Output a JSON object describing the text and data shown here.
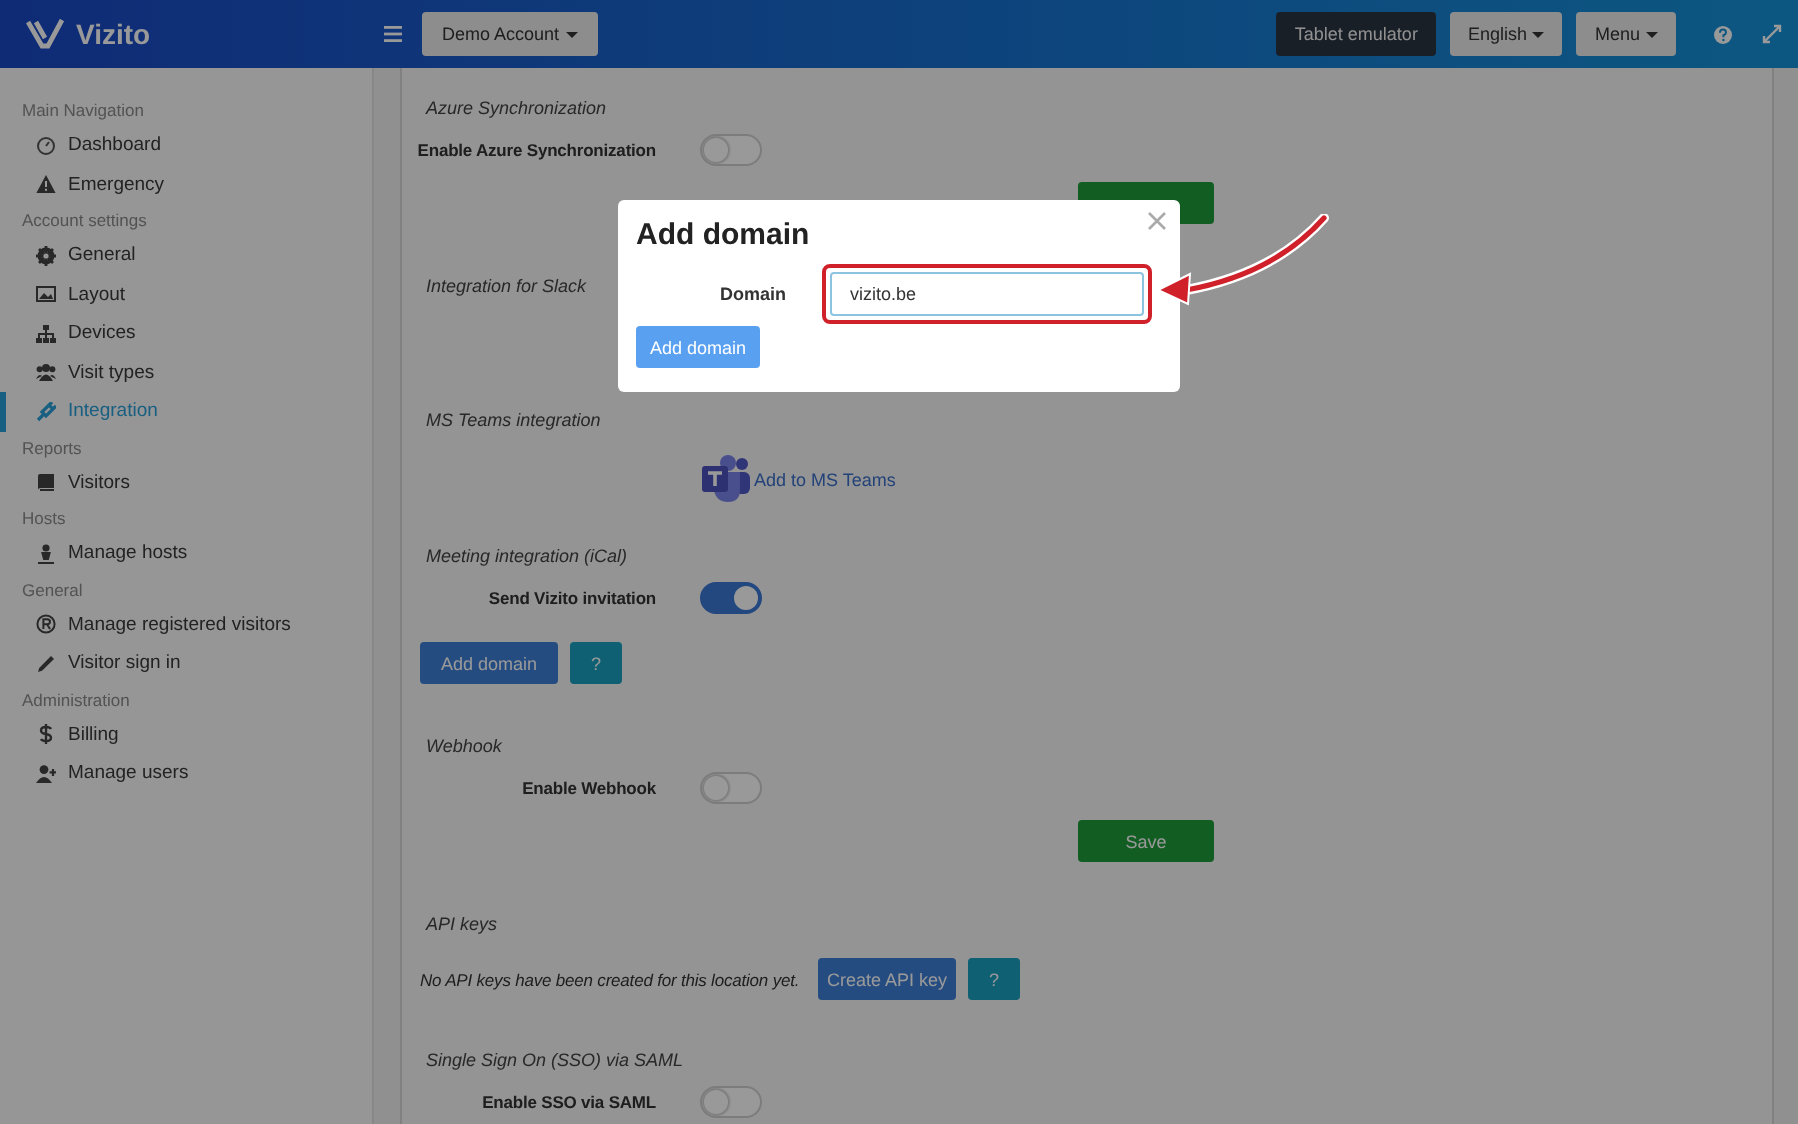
{
  "header": {
    "logo": "Vizito",
    "account": "Demo Account",
    "tablet": "Tablet emulator",
    "language": "English",
    "menu": "Menu"
  },
  "sidebar": {
    "groups": [
      {
        "heading": "Main Navigation",
        "items": [
          {
            "label": "Dashboard",
            "selected": false
          },
          {
            "label": "Emergency",
            "selected": false
          }
        ]
      },
      {
        "heading": "Account settings",
        "items": [
          {
            "label": "General",
            "selected": false
          },
          {
            "label": "Layout",
            "selected": false
          },
          {
            "label": "Devices",
            "selected": false
          },
          {
            "label": "Visit types",
            "selected": false
          },
          {
            "label": "Integration",
            "selected": true
          }
        ]
      },
      {
        "heading": "Reports",
        "items": [
          {
            "label": "Visitors",
            "selected": false
          }
        ]
      },
      {
        "heading": "Hosts",
        "items": [
          {
            "label": "Manage hosts",
            "selected": false
          }
        ]
      },
      {
        "heading": "General",
        "items": [
          {
            "label": "Manage registered visitors",
            "selected": false
          },
          {
            "label": "Visitor sign in",
            "selected": false
          }
        ]
      },
      {
        "heading": "Administration",
        "items": [
          {
            "label": "Billing",
            "selected": false
          },
          {
            "label": "Manage users",
            "selected": false
          }
        ]
      }
    ]
  },
  "sections": [
    {
      "kind": "toggle",
      "title": "Azure Synchronization",
      "label": "Enable Azure Synchronization",
      "on": false,
      "save_button": true
    },
    {
      "kind": "blank",
      "title": "Integration for Slack"
    },
    {
      "kind": "teams",
      "title": "MS Teams integration",
      "link": "Add to MS Teams"
    },
    {
      "kind": "toggle",
      "title": "Meeting integration (iCal)",
      "label": "Send Vizito invitation",
      "on": true,
      "buttons": [
        "Add domain",
        "?"
      ]
    },
    {
      "kind": "toggle",
      "title": "Webhook",
      "label": "Enable Webhook",
      "on": false,
      "save_button": true,
      "save": "Save"
    },
    {
      "kind": "apikeys",
      "title": "API keys",
      "note": "No API keys have been created for this location yet.",
      "buttons": [
        "Create API key",
        "?"
      ]
    },
    {
      "kind": "toggle",
      "title": "Single Sign On (SSO) via SAML",
      "label": "Enable SSO via SAML",
      "on": false
    }
  ],
  "dialog": {
    "title": "Add domain",
    "field_label": "Domain",
    "value": "vizito.be",
    "button": "Add domain"
  }
}
